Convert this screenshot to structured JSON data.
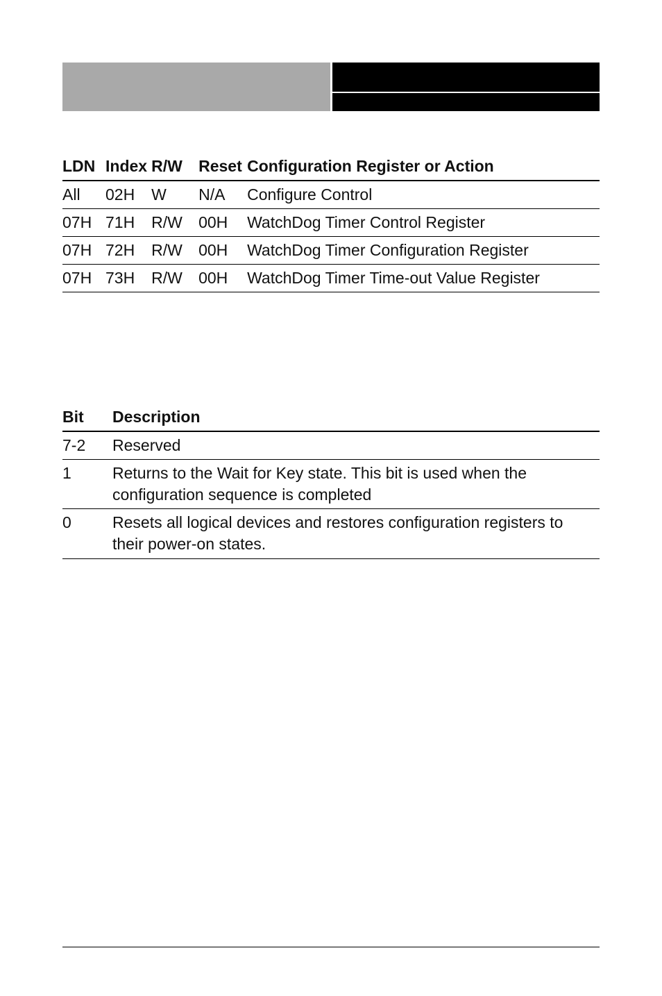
{
  "table1": {
    "headers": {
      "ldn": "LDN",
      "index": "Index",
      "rw": "R/W",
      "reset": "Reset",
      "config": "Configuration Register or Action"
    },
    "rows": [
      {
        "ldn": "All",
        "index": "02H",
        "rw": "W",
        "reset": "N/A",
        "config": "Configure Control"
      },
      {
        "ldn": "07H",
        "index": "71H",
        "rw": "R/W",
        "reset": "00H",
        "config": "WatchDog Timer Control Register"
      },
      {
        "ldn": "07H",
        "index": "72H",
        "rw": "R/W",
        "reset": "00H",
        "config": "WatchDog Timer Configuration Register"
      },
      {
        "ldn": "07H",
        "index": "73H",
        "rw": "R/W",
        "reset": "00H",
        "config": "WatchDog Timer Time-out Value Register"
      }
    ]
  },
  "table2": {
    "headers": {
      "bit": "Bit",
      "desc": "Description"
    },
    "rows": [
      {
        "bit": "7-2",
        "desc": "Reserved"
      },
      {
        "bit": "1",
        "desc": "Returns to the Wait for Key state. This bit is used when the configuration sequence is completed"
      },
      {
        "bit": "0",
        "desc": "Resets all logical devices and restores configuration registers to their power-on states."
      }
    ]
  }
}
